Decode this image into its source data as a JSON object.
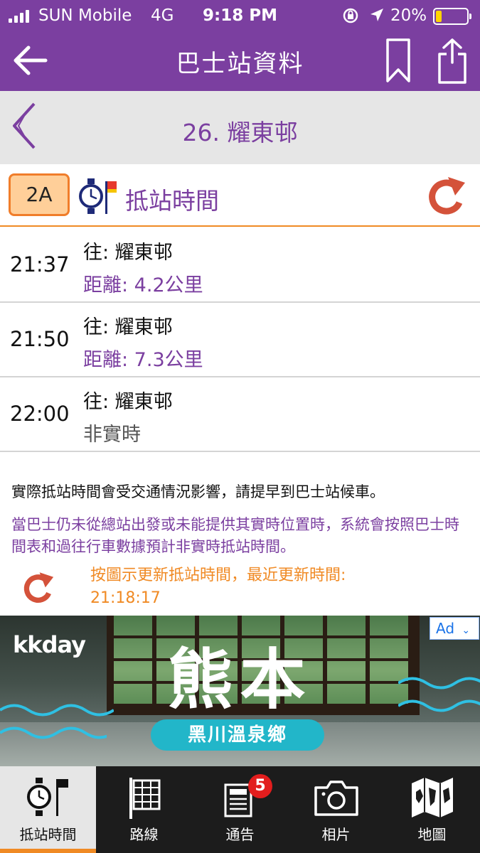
{
  "status_bar": {
    "carrier": "SUN Mobile",
    "network": "4G",
    "time": "9:18 PM",
    "battery": "20%",
    "battery_level": 0.2
  },
  "nav": {
    "title": "巴士站資料"
  },
  "stop": {
    "name": "26. 耀東邨"
  },
  "route": {
    "number": "2A",
    "heading": "抵站時間"
  },
  "etas": [
    {
      "time": "21:37",
      "destination": "往: 耀東邨",
      "info": "距離: 4.2公里"
    },
    {
      "time": "21:50",
      "destination": "往: 耀東邨",
      "info": "距離: 7.3公里"
    },
    {
      "time": "22:00",
      "destination": "往: 耀東邨",
      "info": "非實時"
    }
  ],
  "notes": {
    "traffic": "實際抵站時間會受交通情況影響，請提早到巴士站候車。",
    "estimate": "當巴士仍未從總站出發或未能提供其實時位置時，系統會按照巴士時間表和過往行車數據預計非實時抵站時間。",
    "refresh_line1": "按圖示更新抵站時間，最近更新時間:",
    "refresh_time": "21:18:17"
  },
  "ad": {
    "brand": "kkday",
    "title": "熊本",
    "subtitle": "黑川溫泉鄉",
    "badge": "Ad"
  },
  "tabs": [
    {
      "label": "抵站時間",
      "icon": "eta-icon"
    },
    {
      "label": "路線",
      "icon": "route-icon"
    },
    {
      "label": "通告",
      "icon": "notice-icon",
      "badge": "5"
    },
    {
      "label": "相片",
      "icon": "camera-icon"
    },
    {
      "label": "地圖",
      "icon": "map-icon"
    }
  ],
  "colors": {
    "brand_purple": "#7b3fa0",
    "accent_orange": "#f08a24",
    "refresh_red": "#d4523a"
  }
}
